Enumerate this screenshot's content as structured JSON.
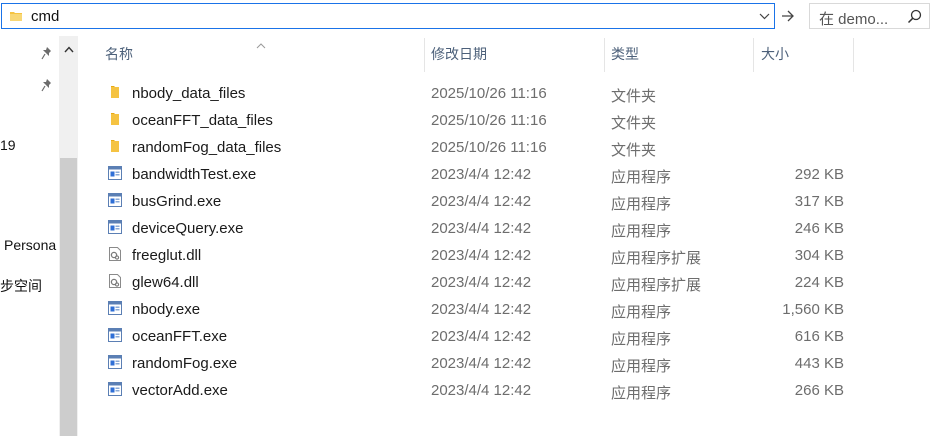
{
  "address_bar": {
    "path": "cmd",
    "folder_icon": "folder-icon",
    "dropdown_icon": "chevron-down-icon"
  },
  "go_button": {
    "icon": "arrow-right-icon"
  },
  "search": {
    "placeholder": "在 demo...",
    "icon": "search-icon"
  },
  "nav": {
    "partial_items": [
      "19",
      "Persona",
      "步空间"
    ]
  },
  "columns": {
    "name": "名称",
    "date": "修改日期",
    "type": "类型",
    "size": "大小"
  },
  "files": [
    {
      "name": "nbody_data_files",
      "date": "2025/10/26 11:16",
      "type": "文件夹",
      "size": "",
      "icon": "folder-icon"
    },
    {
      "name": "oceanFFT_data_files",
      "date": "2025/10/26 11:16",
      "type": "文件夹",
      "size": "",
      "icon": "folder-icon"
    },
    {
      "name": "randomFog_data_files",
      "date": "2025/10/26 11:16",
      "type": "文件夹",
      "size": "",
      "icon": "folder-icon"
    },
    {
      "name": "bandwidthTest.exe",
      "date": "2023/4/4 12:42",
      "type": "应用程序",
      "size": "292 KB",
      "icon": "exe-icon"
    },
    {
      "name": "busGrind.exe",
      "date": "2023/4/4 12:42",
      "type": "应用程序",
      "size": "317 KB",
      "icon": "exe-icon"
    },
    {
      "name": "deviceQuery.exe",
      "date": "2023/4/4 12:42",
      "type": "应用程序",
      "size": "246 KB",
      "icon": "exe-icon"
    },
    {
      "name": "freeglut.dll",
      "date": "2023/4/4 12:42",
      "type": "应用程序扩展",
      "size": "304 KB",
      "icon": "dll-icon"
    },
    {
      "name": "glew64.dll",
      "date": "2023/4/4 12:42",
      "type": "应用程序扩展",
      "size": "224 KB",
      "icon": "dll-icon"
    },
    {
      "name": "nbody.exe",
      "date": "2023/4/4 12:42",
      "type": "应用程序",
      "size": "1,560 KB",
      "icon": "exe-icon"
    },
    {
      "name": "oceanFFT.exe",
      "date": "2023/4/4 12:42",
      "type": "应用程序",
      "size": "616 KB",
      "icon": "exe-icon"
    },
    {
      "name": "randomFog.exe",
      "date": "2023/4/4 12:42",
      "type": "应用程序",
      "size": "443 KB",
      "icon": "exe-icon"
    },
    {
      "name": "vectorAdd.exe",
      "date": "2023/4/4 12:42",
      "type": "应用程序",
      "size": "266 KB",
      "icon": "exe-icon"
    }
  ],
  "colors": {
    "accent": "#1a73e8",
    "folder": "#f5c342",
    "header_text": "#4c607a"
  }
}
